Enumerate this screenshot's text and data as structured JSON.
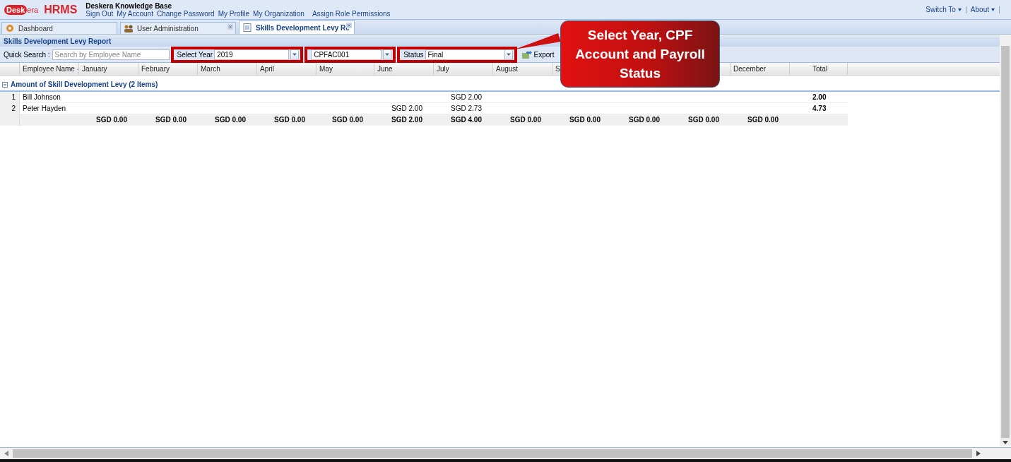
{
  "header": {
    "logo": {
      "badge": "Desk",
      "rest": "era",
      "product": "HRMS"
    },
    "title": "Deskera Knowledge Base",
    "links": [
      "Sign Out",
      "My Account",
      "Change Password",
      "My Profile",
      "My Organization",
      "Assign Role Permissions"
    ],
    "right_menu": [
      "Switch To",
      "About"
    ]
  },
  "tabs": [
    {
      "label": "Dashboard",
      "selected": false,
      "closable": false
    },
    {
      "label": "User Administration",
      "selected": false,
      "closable": true
    },
    {
      "label": "Skills Development Levy Re",
      "selected": true,
      "closable": true
    }
  ],
  "report": {
    "title": "Skills Development Levy Report",
    "toolbar": {
      "quick_search": {
        "label": "Quick Search :",
        "placeholder": "Search by Employee Name"
      },
      "year": {
        "label": "Select Year",
        "value": "2019"
      },
      "cpf_account": {
        "value": "CPFAC001"
      },
      "status": {
        "label": "Status",
        "value": "Final"
      },
      "export_button": "Export"
    },
    "columns": {
      "employee_name": {
        "label": "Employee Name",
        "sorted": true
      },
      "january": {
        "label": "January"
      },
      "february": {
        "label": "February"
      },
      "march": {
        "label": "March"
      },
      "april": {
        "label": "April"
      },
      "may": {
        "label": "May"
      },
      "june": {
        "label": "June"
      },
      "july": {
        "label": "July"
      },
      "august": {
        "label": "August"
      },
      "september": {
        "label": "S"
      },
      "december": {
        "label": "December"
      },
      "total": {
        "label": "Total"
      }
    },
    "group": {
      "title": "Amount of Skill Development Levy (2 Items)",
      "expanded": true
    },
    "rows": [
      {
        "number": "1",
        "name": "Bill Johnson",
        "july": "SGD 2.00",
        "total": "2.00"
      },
      {
        "number": "2",
        "name": "Peter Hayden",
        "june": "SGD 2.00",
        "july": "SGD 2.73",
        "total": "4.73"
      }
    ],
    "summary": [
      "SGD 0.00",
      "SGD 0.00",
      "SGD 0.00",
      "SGD 0.00",
      "SGD 0.00",
      "SGD 2.00",
      "SGD 4.00",
      "SGD 0.00",
      "SGD 0.00",
      "SGD 0.00",
      "SGD 0.00",
      "SGD 0.00"
    ]
  },
  "callout": {
    "text": "Select Year, CPF Account and Payroll Status"
  }
}
